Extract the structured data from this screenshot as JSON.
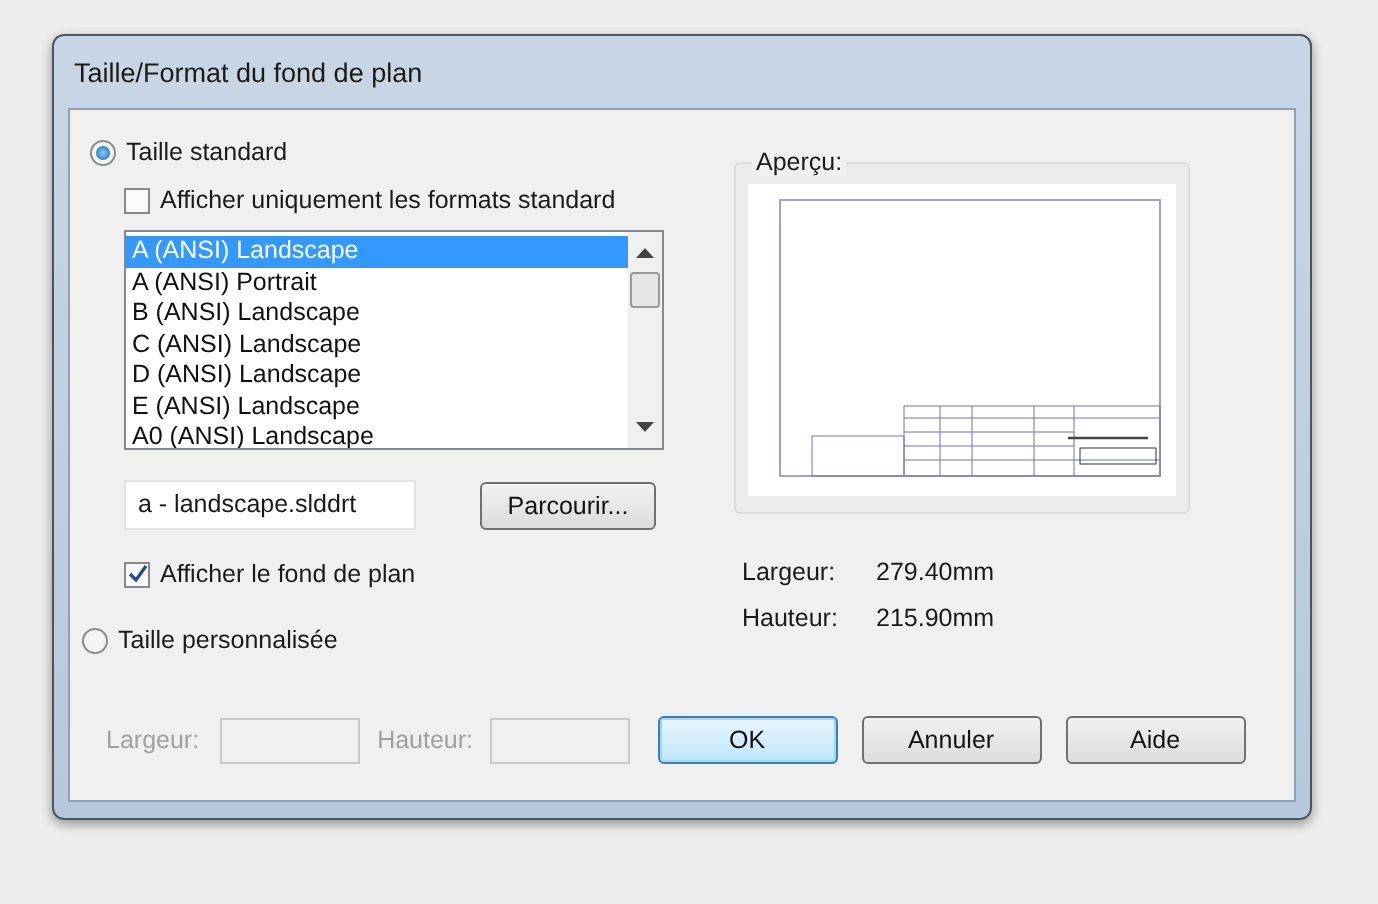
{
  "window": {
    "title": "Taille/Format du fond de plan"
  },
  "standard": {
    "label": "Taille standard",
    "selected": true
  },
  "only_standard": {
    "label": "Afficher uniquement les formats standard",
    "checked": false
  },
  "formats": [
    {
      "label": "A (ANSI) Landscape",
      "selected": true
    },
    {
      "label": "A (ANSI) Portrait",
      "selected": false
    },
    {
      "label": "B (ANSI) Landscape",
      "selected": false
    },
    {
      "label": "C (ANSI) Landscape",
      "selected": false
    },
    {
      "label": "D (ANSI) Landscape",
      "selected": false
    },
    {
      "label": "E (ANSI) Landscape",
      "selected": false
    },
    {
      "label": "A0 (ANSI) Landscape",
      "selected": false
    }
  ],
  "template_file": {
    "value": "a - landscape.slddrt"
  },
  "browse_button": {
    "label": "Parcourir..."
  },
  "show_sheet": {
    "label": "Afficher le fond de plan",
    "checked": true
  },
  "custom": {
    "label": "Taille personnalisée",
    "selected": false,
    "disabled": true,
    "width_label": "Largeur:",
    "height_label": "Hauteur:"
  },
  "preview": {
    "title": "Aperçu:",
    "width_label": "Largeur:",
    "width": "279.40mm",
    "height_label": "Hauteur:",
    "height": "215.90mm"
  },
  "buttons": [
    {
      "label": "OK",
      "default": true
    },
    {
      "label": "Annuler",
      "default": false
    },
    {
      "label": "Aide",
      "default": false
    }
  ]
}
